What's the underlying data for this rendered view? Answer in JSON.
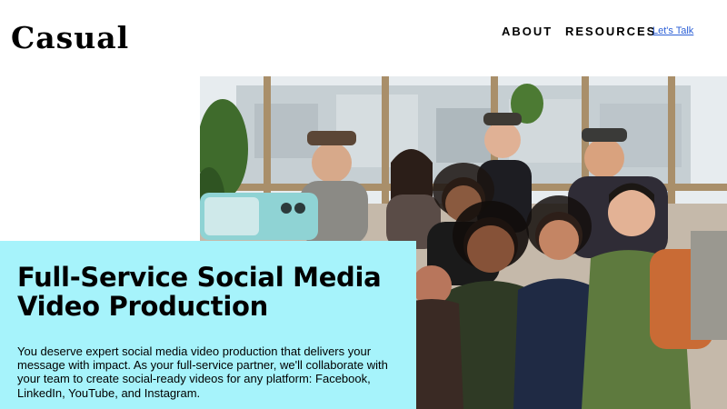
{
  "header": {
    "logo_text": "Casual",
    "nav": {
      "about": "ABOUT",
      "resources": "RESOURCES",
      "cta": "Let's Talk"
    }
  },
  "hero": {
    "title": "Full-Service Social Media Video Production",
    "body": "You deserve expert social media video production that delivers your message with impact. As your full-service partner, we'll collaborate with your team to create social-ready videos for any platform: Facebook, LinkedIn, YouTube, and Instagram."
  },
  "colors": {
    "hero_card_bg": "#a6f3fb",
    "link": "#2b5fd6",
    "text": "#000000"
  }
}
